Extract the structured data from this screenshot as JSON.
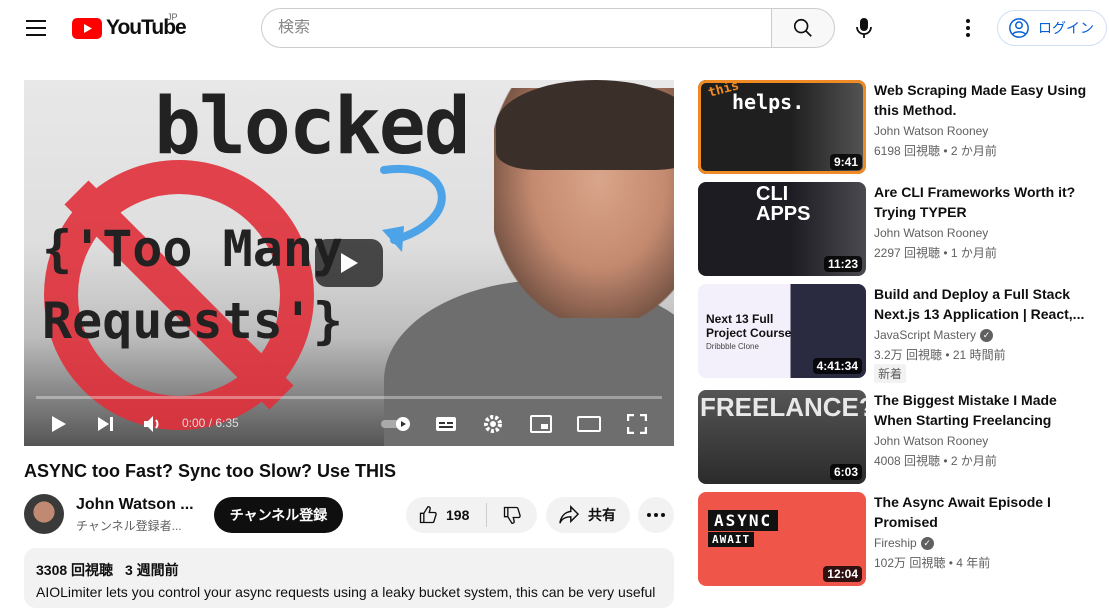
{
  "header": {
    "logo_text": "YouTube",
    "logo_country": "JP",
    "search_placeholder": "検索",
    "login_label": "ログイン"
  },
  "player": {
    "thumb_word_1": "blocked",
    "thumb_word_2": "{'Too Many",
    "thumb_word_3": "Requests'}",
    "time": "0:00 / 6:35",
    "progress": 0
  },
  "video": {
    "title": "ASYNC too Fast? Sync too Slow? Use THIS",
    "channel_name": "John Watson ...",
    "channel_subs": "チャンネル登録者...",
    "subscribe_label": "チャンネル登録",
    "like_count": "198",
    "share_label": "共有",
    "views": "3308 回視聴",
    "age": "3 週間前",
    "description": "AIOLimiter lets you control your async requests using a leaky bucket system, this can be very useful"
  },
  "recommendations": [
    {
      "title": "Web Scraping Made Easy Using this Method.",
      "channel": "John Watson Rooney",
      "verified": false,
      "meta": "6198 回視聴 • 2 か月前",
      "duration": "9:41",
      "thumb_text": "helps.",
      "thumb_small": "this",
      "thumb_color": "#2b2b2b",
      "badge": ""
    },
    {
      "title": "Are CLI Frameworks Worth it? Trying TYPER",
      "channel": "John Watson Rooney",
      "verified": false,
      "meta": "2297 回視聴 • 1 か月前",
      "duration": "11:23",
      "thumb_text": "CLI APPS",
      "thumb_small": "",
      "thumb_color": "#2a2a2e",
      "badge": ""
    },
    {
      "title": "Build and Deploy a Full Stack Next.js 13 Application | React,...",
      "channel": "JavaScript Mastery",
      "verified": true,
      "meta": "3.2万 回視聴 • 21 時間前",
      "duration": "4:41:34",
      "thumb_text": "Next 13 Full Project Course",
      "thumb_small": "Dribbble Clone",
      "thumb_color": "#f4f0fb",
      "badge": "新着"
    },
    {
      "title": "The Biggest Mistake I Made When Starting Freelancing",
      "channel": "John Watson Rooney",
      "verified": false,
      "meta": "4008 回視聴 • 2 か月前",
      "duration": "6:03",
      "thumb_text": "FREELANCE?",
      "thumb_small": "",
      "thumb_color": "#3a3a3a",
      "badge": ""
    },
    {
      "title": "The Async Await Episode I Promised",
      "channel": "Fireship",
      "verified": true,
      "meta": "102万 回視聴 • 4 年前",
      "duration": "12:04",
      "thumb_text": "ASYNC",
      "thumb_small": "AWAIT",
      "thumb_color": "#f0554a",
      "badge": ""
    }
  ],
  "colors": {
    "youtube_red": "#ff0000",
    "link_blue": "#065fd4",
    "no_sign_red": "#e0303b"
  }
}
